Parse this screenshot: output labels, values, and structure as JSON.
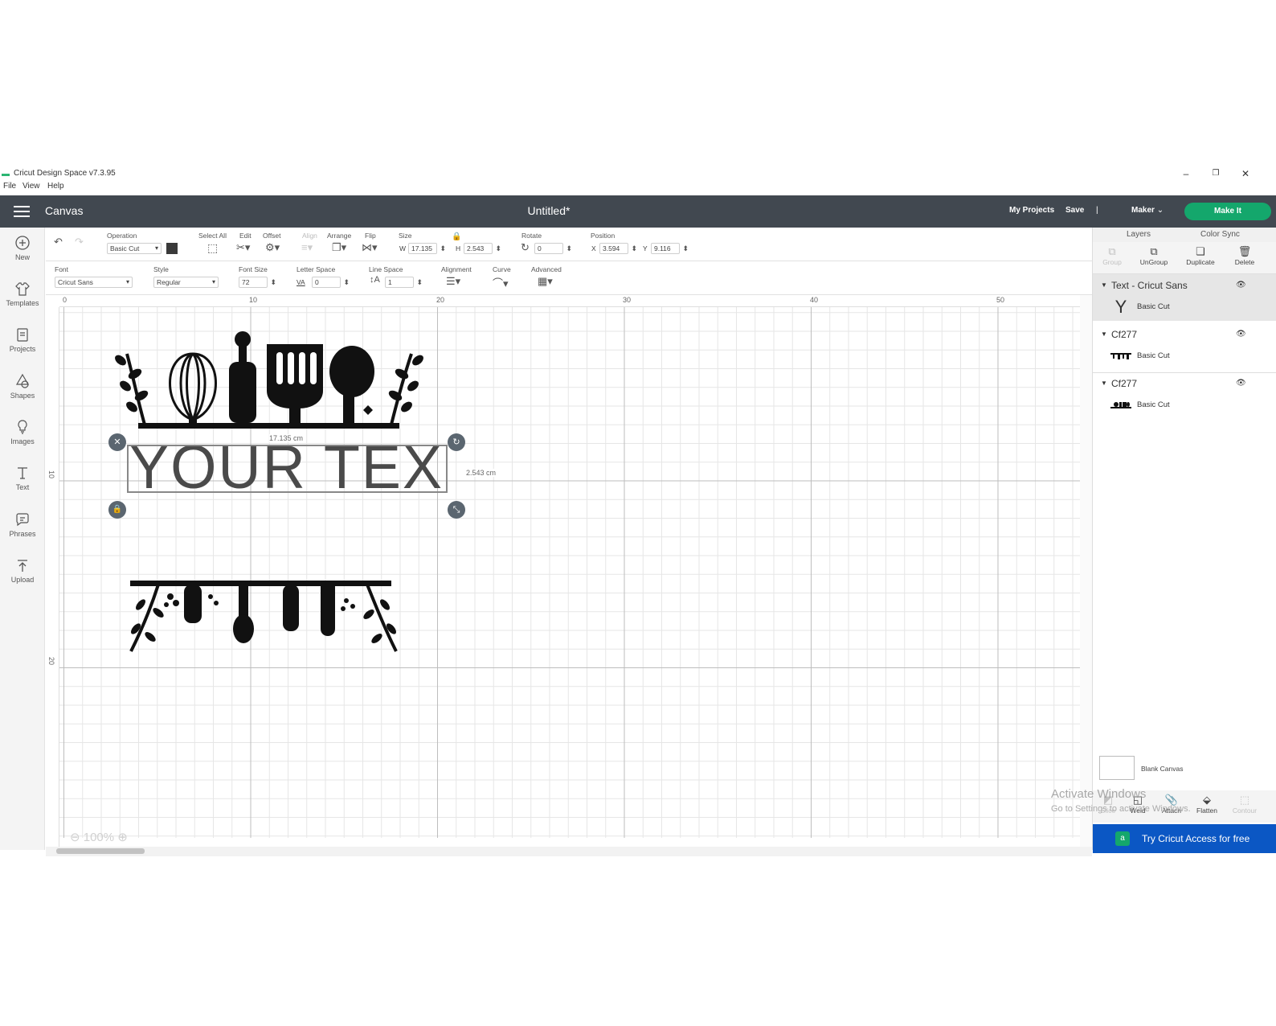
{
  "window": {
    "title": "Cricut Design Space  v7.3.95",
    "menu": [
      "File",
      "View",
      "Help"
    ],
    "controls": [
      "minimize",
      "restore",
      "close"
    ]
  },
  "header": {
    "section": "Canvas",
    "doc_title": "Untitled*",
    "my_projects": "My Projects",
    "save": "Save",
    "separator": "|",
    "machine": "Maker",
    "make_it": "Make It",
    "accent_color": "#14a76c",
    "bar_color": "#414850"
  },
  "leftrail": {
    "items": [
      {
        "label": "New",
        "icon": "plus-circle-icon"
      },
      {
        "label": "Templates",
        "icon": "shirt-icon"
      },
      {
        "label": "Projects",
        "icon": "projects-icon"
      },
      {
        "label": "Shapes",
        "icon": "shapes-icon"
      },
      {
        "label": "Images",
        "icon": "lightbulb-icon"
      },
      {
        "label": "Text",
        "icon": "text-icon"
      },
      {
        "label": "Phrases",
        "icon": "speech-bubble-icon"
      },
      {
        "label": "Upload",
        "icon": "upload-icon"
      }
    ]
  },
  "toolbar1": {
    "operation_label": "Operation",
    "operation_value": "Basic Cut",
    "select_all": "Select All",
    "edit": "Edit",
    "offset": "Offset",
    "align": "Align",
    "arrange": "Arrange",
    "flip": "Flip",
    "size": "Size",
    "w_prefix": "W",
    "w_value": "17.135",
    "h_prefix": "H",
    "h_value": "2.543",
    "rotate": "Rotate",
    "rotate_value": "0",
    "position": "Position",
    "x_prefix": "X",
    "x_value": "3.594",
    "y_prefix": "Y",
    "y_value": "9.116",
    "swatch_color": "#3a3a3a"
  },
  "toolbar2": {
    "font_label": "Font",
    "font_value": "Cricut Sans",
    "style_label": "Style",
    "style_value": "Regular",
    "font_size_label": "Font Size",
    "font_size_value": "72",
    "letter_space_label": "Letter Space",
    "letter_space_prefix": "VA",
    "letter_space_value": "0",
    "line_space_label": "Line Space",
    "line_space_value": "1",
    "alignment_label": "Alignment",
    "curve_label": "Curve",
    "advanced_label": "Advanced"
  },
  "canvas": {
    "ruler_top": [
      "0",
      "10",
      "20",
      "30",
      "40",
      "50"
    ],
    "ruler_left": [
      "10",
      "20"
    ],
    "text_object": "YOUR TEXT",
    "width_readout": "17.135 cm",
    "height_readout": "2.543 cm",
    "zoom": "100%"
  },
  "rightpanel": {
    "tabs": [
      "Layers",
      "Color Sync"
    ],
    "actions": [
      {
        "label": "Group",
        "icon": "group-icon",
        "enabled": false
      },
      {
        "label": "UnGroup",
        "icon": "ungroup-icon",
        "enabled": true
      },
      {
        "label": "Duplicate",
        "icon": "duplicate-icon",
        "enabled": true
      },
      {
        "label": "Delete",
        "icon": "trash-icon",
        "enabled": true
      }
    ],
    "layers": [
      {
        "name": "Text - Cricut Sans",
        "op": "Basic Cut",
        "thumb": "Y"
      },
      {
        "name": "Cf277",
        "op": "Basic Cut",
        "thumb": ""
      },
      {
        "name": "Cf277",
        "op": "Basic Cut",
        "thumb": ""
      }
    ],
    "blank_canvas": "Blank Canvas",
    "bottom_actions": [
      {
        "label": "Slice",
        "icon": "slice-icon",
        "enabled": false
      },
      {
        "label": "Weld",
        "icon": "weld-icon",
        "enabled": true
      },
      {
        "label": "Attach",
        "icon": "attach-icon",
        "enabled": true
      },
      {
        "label": "Flatten",
        "icon": "flatten-icon",
        "enabled": true
      },
      {
        "label": "Contour",
        "icon": "contour-icon",
        "enabled": false
      }
    ],
    "try_access": "Try Cricut Access for free",
    "try_access_color": "#0b57c4"
  },
  "watermark": {
    "line1": "Activate Windows",
    "line2": "Go to Settings to activate Windows."
  }
}
